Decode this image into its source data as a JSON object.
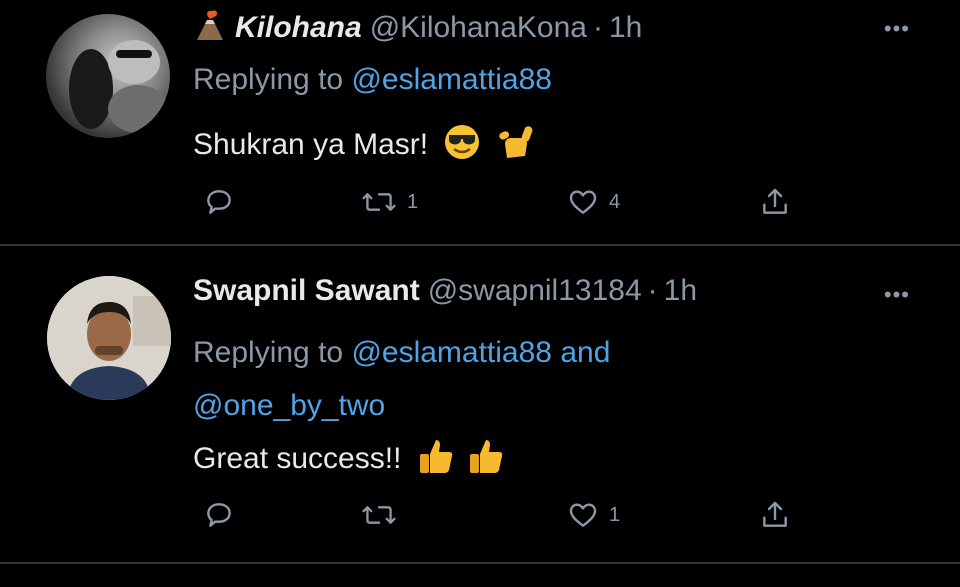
{
  "tweets": [
    {
      "name": "Kilohana",
      "handle": "@KilohanaKona",
      "time": "1h",
      "replying_label": "Replying to",
      "mention": "@eslamattia88",
      "mention_2": "",
      "and_label": "",
      "text": "Shukran ya Masr!",
      "emojis": [
        "sunglasses-face-emoji",
        "call-me-hand-emoji"
      ],
      "retweets": "1",
      "likes": "4"
    },
    {
      "name": "Swapnil Sawant",
      "handle": "@swapnil13184",
      "time": "1h",
      "replying_label": "Replying to",
      "mention": "@eslamattia88",
      "and_label": "and",
      "mention_2": "@one_by_two",
      "text": "Great success!!",
      "emojis": [
        "thumbs-up-emoji",
        "thumbs-up-emoji"
      ],
      "retweets": "",
      "likes": "1"
    }
  ],
  "colors": {
    "background": "#000000",
    "text": "#e7e9ea",
    "muted": "#8b98a5",
    "accent": "#4fa3e6",
    "divider": "#2f3336"
  },
  "icons": [
    "more-icon",
    "reply-icon",
    "retweet-icon",
    "like-icon",
    "share-icon",
    "volcano-icon"
  ]
}
